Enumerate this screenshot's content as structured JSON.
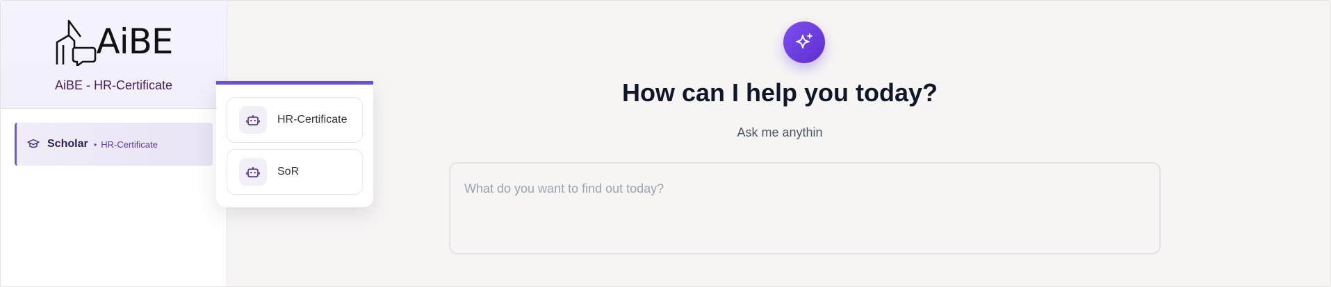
{
  "brand": {
    "logo_text": "AiBE",
    "subtitle": "AiBE - HR-Certificate"
  },
  "sidebar": {
    "items": [
      {
        "icon": "graduation-cap-icon",
        "label": "Scholar",
        "separator": "•",
        "sub_label": "HR-Certificate"
      }
    ]
  },
  "dropdown": {
    "options": [
      {
        "icon": "robot-icon",
        "label": "HR-Certificate"
      },
      {
        "icon": "robot-icon",
        "label": "SoR"
      }
    ]
  },
  "main": {
    "icon": "sparkle-icon",
    "heading": "How can I help you today?",
    "subheading": "Ask me anythin",
    "prompt_placeholder": "What do you want to find out today?",
    "prompt_value": ""
  },
  "colors": {
    "accent": "#6a4fd8",
    "brand_text": "#4a1b5e",
    "heading": "#0f172a"
  }
}
